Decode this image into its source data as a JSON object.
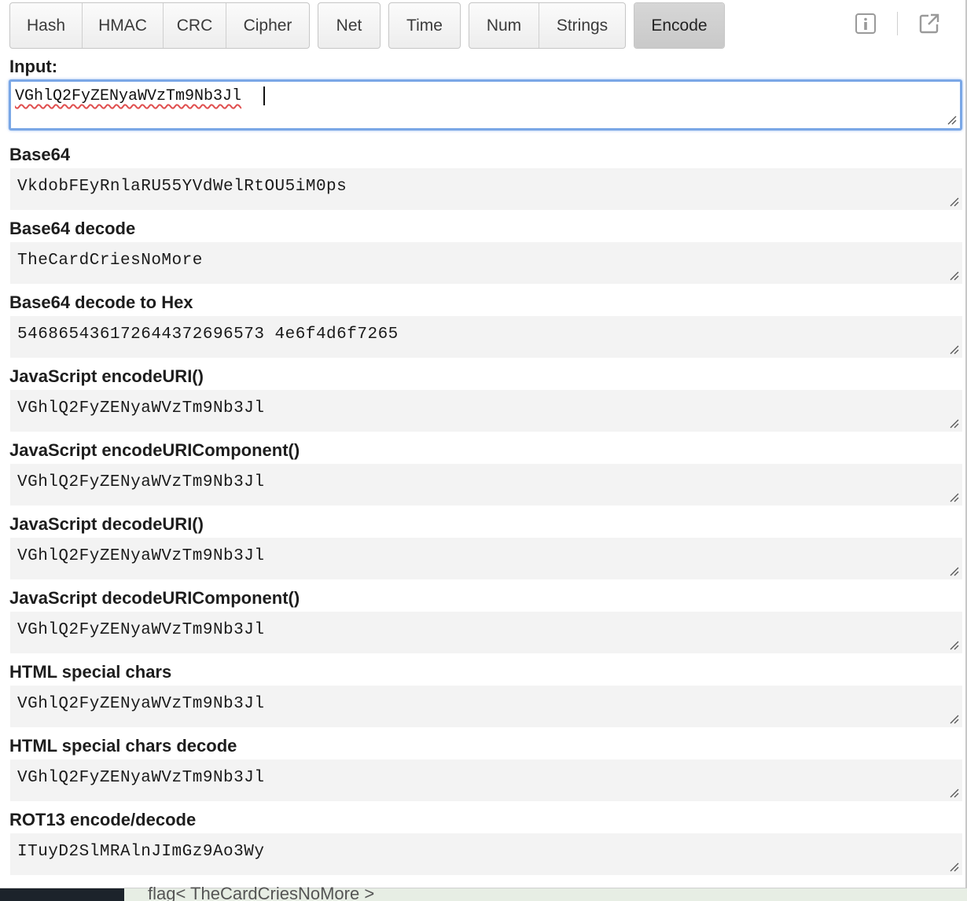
{
  "tabs": {
    "hash": "Hash",
    "hmac": "HMAC",
    "crc": "CRC",
    "cipher": "Cipher",
    "net": "Net",
    "time": "Time",
    "num": "Num",
    "strings": "Strings",
    "encode": "Encode"
  },
  "icons": {
    "info": "info-icon",
    "popout": "external-link-icon"
  },
  "input": {
    "label": "Input:",
    "value": "VGhlQ2FyZENyaWVzTm9Nb3Jl"
  },
  "outputs": [
    {
      "label": "Base64",
      "value": "VkdobFEyRnlaRU55YVdWelRtOU5iM0ps"
    },
    {
      "label": "Base64 decode",
      "value": "TheCardCriesNoMore"
    },
    {
      "label": "Base64 decode to Hex",
      "value": "546865436172644372696573 4e6f4d6f7265"
    },
    {
      "label": "JavaScript encodeURI()",
      "value": "VGhlQ2FyZENyaWVzTm9Nb3Jl"
    },
    {
      "label": "JavaScript encodeURIComponent()",
      "value": "VGhlQ2FyZENyaWVzTm9Nb3Jl"
    },
    {
      "label": "JavaScript decodeURI()",
      "value": "VGhlQ2FyZENyaWVzTm9Nb3Jl"
    },
    {
      "label": "JavaScript decodeURIComponent()",
      "value": "VGhlQ2FyZENyaWVzTm9Nb3Jl"
    },
    {
      "label": "HTML special chars",
      "value": "VGhlQ2FyZENyaWVzTm9Nb3Jl"
    },
    {
      "label": "HTML special chars decode",
      "value": "VGhlQ2FyZENyaWVzTm9Nb3Jl"
    },
    {
      "label": "ROT13 encode/decode",
      "value": "ITuyD2SlMRAlnJImGz9Ao3Wy"
    }
  ],
  "background": {
    "text": "flag< TheCardCriesNoMore >"
  }
}
